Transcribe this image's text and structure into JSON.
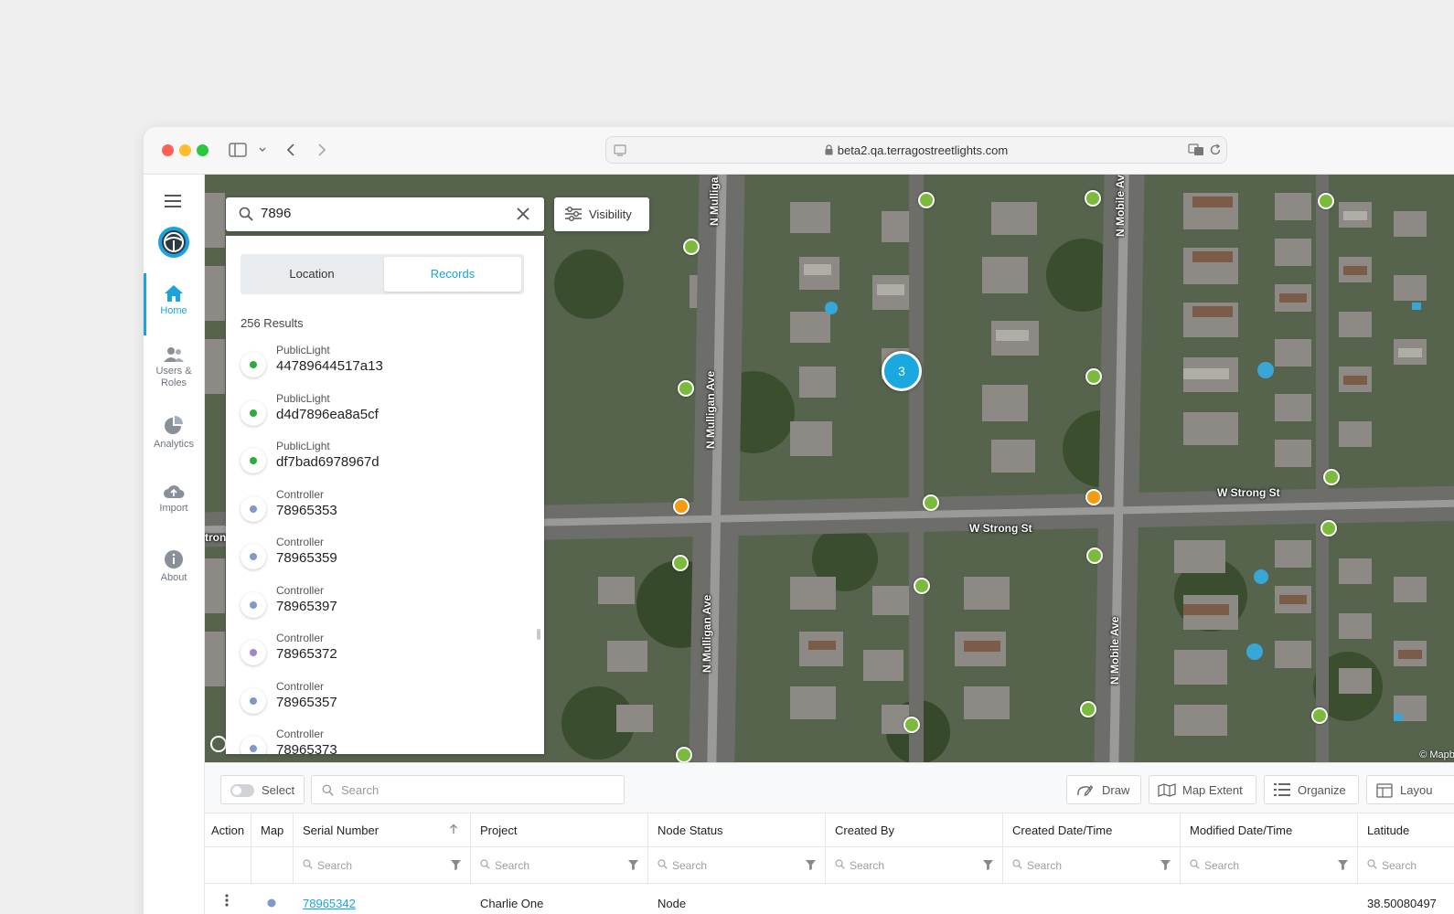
{
  "browser": {
    "url": "beta2.qa.terragostreetlights.com"
  },
  "nav": {
    "items": [
      {
        "label": "Home"
      },
      {
        "label": "Users &",
        "label2": "Roles"
      },
      {
        "label": "Analytics"
      },
      {
        "label": "Import"
      },
      {
        "label": "About"
      }
    ]
  },
  "map": {
    "search_value": "7896",
    "visibility_label": "Visibility",
    "cluster_count": "3",
    "streets": [
      "N Mulligan Ave",
      "N Mulligan Ave",
      "N Mulligan Ave",
      "N Mobile Ave",
      "N Mobile Ave",
      "W Strong St",
      "W Strong St"
    ],
    "partial_labels": [
      "N Mulliga",
      "N Mobile Av",
      "tron"
    ],
    "attribution": "© Mapbo",
    "colors": {
      "green": "#7cba3d",
      "orange": "#f39c12",
      "cluster": "#1aa8e0"
    }
  },
  "results": {
    "tabs": [
      "Location",
      "Records"
    ],
    "active_tab": "Records",
    "count_text": "256 Results",
    "items": [
      {
        "type": "PublicLight",
        "id": "44789644517a13",
        "status_color": "#2eaa3f"
      },
      {
        "type": "PublicLight",
        "id": "d4d7896ea8a5cf",
        "status_color": "#2eaa3f"
      },
      {
        "type": "PublicLight",
        "id": "df7bad6978967d",
        "status_color": "#2eaa3f"
      },
      {
        "type": "Controller",
        "id": "78965353",
        "status_color": "#7f9ac6"
      },
      {
        "type": "Controller",
        "id": "78965359",
        "status_color": "#7f9ac6"
      },
      {
        "type": "Controller",
        "id": "78965397",
        "status_color": "#7f9ac6"
      },
      {
        "type": "Controller",
        "id": "78965372",
        "status_color": "#a386c9"
      },
      {
        "type": "Controller",
        "id": "78965357",
        "status_color": "#7f9ac6"
      },
      {
        "type": "Controller",
        "id": "78965373",
        "status_color": "#7f9ac6"
      }
    ]
  },
  "toolbar": {
    "select_label": "Select",
    "search_placeholder": "Search",
    "draw_label": "Draw",
    "map_extent_label": "Map Extent",
    "organize_label": "Organize",
    "layout_label": "Layou"
  },
  "table": {
    "columns": [
      "Action",
      "Map",
      "Serial Number",
      "Project",
      "Node Status",
      "Created By",
      "Created Date/Time",
      "Modified Date/Time",
      "Latitude"
    ],
    "filter_placeholder": "Search",
    "rows": [
      {
        "serial": "78965342",
        "project": "Charlie One",
        "node_status": "Node",
        "latitude": "38.50080497"
      }
    ]
  }
}
